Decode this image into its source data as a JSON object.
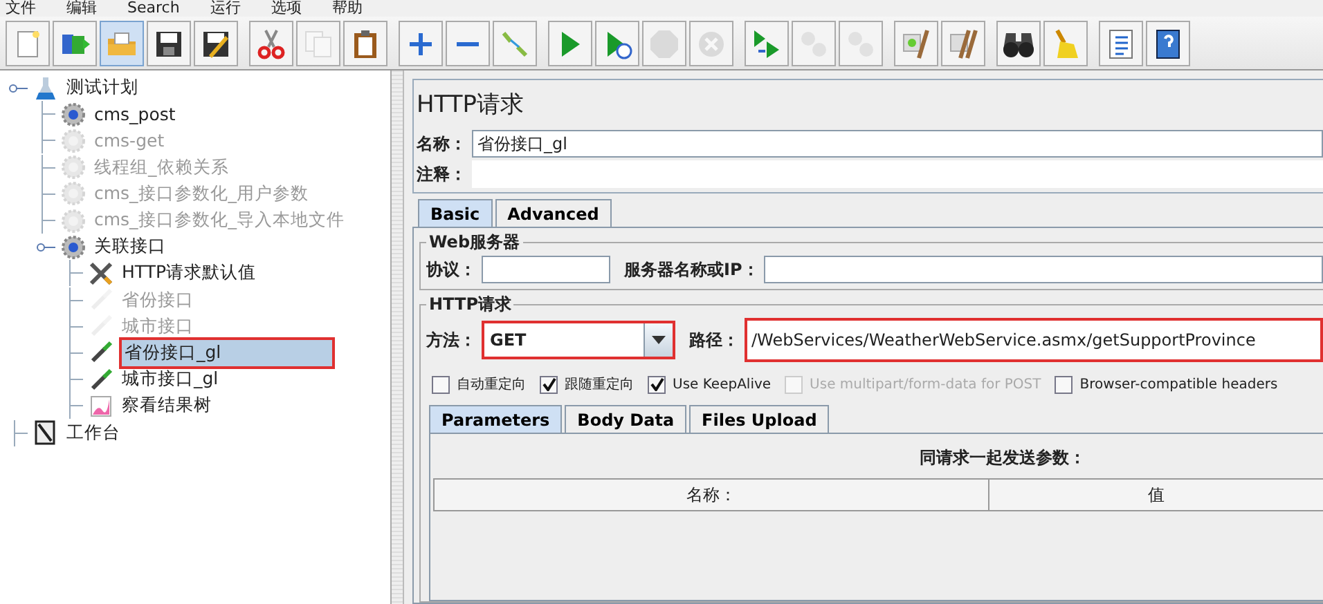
{
  "menu": [
    "文件",
    "编辑",
    "Search",
    "运行",
    "选项",
    "帮助"
  ],
  "toolbar": {
    "groups": [
      [
        {
          "kind": "new",
          "disabled": false,
          "selected": false
        },
        {
          "kind": "templates",
          "disabled": false,
          "selected": false
        },
        {
          "kind": "open",
          "disabled": false,
          "selected": true
        },
        {
          "kind": "save",
          "disabled": false,
          "selected": false
        },
        {
          "kind": "save-as",
          "disabled": false,
          "selected": false
        }
      ],
      [
        {
          "kind": "cut",
          "disabled": false,
          "selected": false
        },
        {
          "kind": "copy",
          "disabled": true,
          "selected": false
        },
        {
          "kind": "paste",
          "disabled": false,
          "selected": false
        }
      ],
      [
        {
          "kind": "expand",
          "disabled": false,
          "selected": false
        },
        {
          "kind": "collapse",
          "disabled": false,
          "selected": false
        },
        {
          "kind": "toggle",
          "disabled": false,
          "selected": false
        }
      ],
      [
        {
          "kind": "start",
          "disabled": false,
          "selected": false
        },
        {
          "kind": "start-no-pause",
          "disabled": false,
          "selected": false
        },
        {
          "kind": "stop",
          "disabled": true,
          "selected": false
        },
        {
          "kind": "shutdown",
          "disabled": true,
          "selected": false
        }
      ],
      [
        {
          "kind": "remote-start",
          "disabled": false,
          "selected": false
        },
        {
          "kind": "remote-stop",
          "disabled": true,
          "selected": false
        },
        {
          "kind": "remote-shutdown",
          "disabled": true,
          "selected": false
        }
      ],
      [
        {
          "kind": "clear",
          "disabled": false,
          "selected": false
        },
        {
          "kind": "clear-all",
          "disabled": false,
          "selected": false
        }
      ],
      [
        {
          "kind": "search",
          "disabled": false,
          "selected": false
        },
        {
          "kind": "reset",
          "disabled": false,
          "selected": false
        }
      ],
      [
        {
          "kind": "functions",
          "disabled": false,
          "selected": false
        },
        {
          "kind": "help",
          "disabled": false,
          "selected": false
        }
      ]
    ]
  },
  "tree": [
    {
      "label": "测试计划",
      "kind": "plan",
      "disabled": false,
      "selected": false,
      "highlighted": false,
      "children": [
        {
          "label": "cms_post",
          "kind": "thread-group",
          "disabled": false,
          "selected": false,
          "highlighted": false
        },
        {
          "label": "cms-get",
          "kind": "thread-group",
          "disabled": true,
          "selected": false,
          "highlighted": false
        },
        {
          "label": "线程组_依赖关系",
          "kind": "thread-group",
          "disabled": true,
          "selected": false,
          "highlighted": false
        },
        {
          "label": "cms_接口参数化_用户参数",
          "kind": "thread-group",
          "disabled": true,
          "selected": false,
          "highlighted": false
        },
        {
          "label": "cms_接口参数化_导入本地文件",
          "kind": "thread-group",
          "disabled": true,
          "selected": false,
          "highlighted": false
        },
        {
          "label": "关联接口",
          "kind": "thread-group",
          "disabled": false,
          "selected": false,
          "highlighted": false,
          "children": [
            {
              "label": "HTTP请求默认值",
              "kind": "config",
              "disabled": false,
              "selected": false,
              "highlighted": false
            },
            {
              "label": "省份接口",
              "kind": "sampler",
              "disabled": true,
              "selected": false,
              "highlighted": false
            },
            {
              "label": "城市接口",
              "kind": "sampler",
              "disabled": true,
              "selected": false,
              "highlighted": false
            },
            {
              "label": "省份接口_gl",
              "kind": "sampler",
              "disabled": false,
              "selected": true,
              "highlighted": true
            },
            {
              "label": "城市接口_gl",
              "kind": "sampler",
              "disabled": false,
              "selected": false,
              "highlighted": false
            },
            {
              "label": "察看结果树",
              "kind": "listener",
              "disabled": false,
              "selected": false,
              "highlighted": false
            }
          ]
        }
      ]
    },
    {
      "label": "工作台",
      "kind": "workbench",
      "disabled": false,
      "selected": false,
      "highlighted": false
    }
  ],
  "panel": {
    "title": "HTTP请求",
    "name": {
      "label": "名称：",
      "value": "省份接口_gl"
    },
    "comment": {
      "label": "注释："
    },
    "tabs": [
      {
        "label": "Basic",
        "selected": true
      },
      {
        "label": "Advanced",
        "selected": false
      }
    ],
    "web_server": {
      "title": "Web服务器",
      "protocol_label": "协议：",
      "server_label": "服务器名称或IP："
    },
    "http_request": {
      "title": "HTTP请求",
      "method": {
        "label": "方法：",
        "value": "GET",
        "highlighted": true
      },
      "path": {
        "label": "路径：",
        "value": "/WebServices/WeatherWebService.asmx/getSupportProvince",
        "highlighted": true
      },
      "options": [
        {
          "label": "自动重定向",
          "checked": false,
          "disabled": false
        },
        {
          "label": "跟随重定向",
          "checked": true,
          "disabled": false
        },
        {
          "label": "Use KeepAlive",
          "checked": true,
          "disabled": false
        },
        {
          "label": "Use multipart/form-data for POST",
          "checked": false,
          "disabled": true
        },
        {
          "label": "Browser-compatible headers",
          "checked": false,
          "disabled": false
        }
      ],
      "tabs": [
        {
          "label": "Parameters",
          "selected": true
        },
        {
          "label": "Body Data",
          "selected": false
        },
        {
          "label": "Files Upload",
          "selected": false
        }
      ],
      "params_title": "同请求一起发送参数：",
      "columns": [
        "名称：",
        "值"
      ]
    }
  }
}
